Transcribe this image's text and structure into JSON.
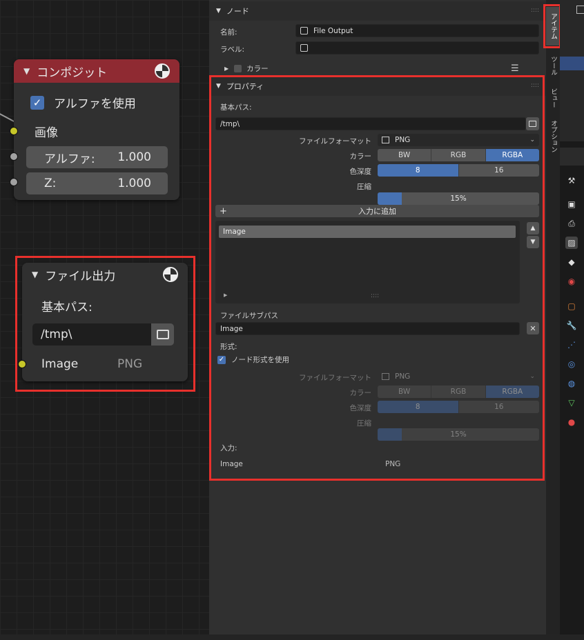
{
  "node_editor": {
    "composite_node": {
      "title": "コンポジット",
      "use_alpha_label": "アルファを使用",
      "use_alpha_checked": true,
      "image_label": "画像",
      "alpha_label": "アルファ:",
      "alpha_value": "1.000",
      "z_label": "Z:",
      "z_value": "1.000"
    },
    "file_output_node": {
      "title": "ファイル出力",
      "base_path_label": "基本パス:",
      "base_path_value": "/tmp\\",
      "input_name": "Image",
      "input_format": "PNG"
    }
  },
  "panel": {
    "node_section": {
      "title": "ノード",
      "name_label": "名前:",
      "name_value": "File Output",
      "label_label": "ラベル:",
      "label_value": "",
      "color_label": "カラー"
    },
    "properties_section": {
      "title": "プロパティ",
      "base_path_label": "基本パス:",
      "base_path_value": "/tmp\\",
      "file_format_label": "ファイルフォーマット",
      "file_format_value": "PNG",
      "color_label": "カラー",
      "color_options": [
        "BW",
        "RGB",
        "RGBA"
      ],
      "color_selected": "RGBA",
      "depth_label": "色深度",
      "depth_options": [
        "8",
        "16"
      ],
      "depth_selected": "8",
      "compression_label": "圧縮",
      "compression_value": "15%",
      "compression_fraction": 0.15,
      "add_input_label": "入力に追加",
      "input_list": [
        "Image"
      ],
      "file_subpath_label": "ファイルサブパス",
      "file_subpath_value": "Image",
      "format_label": "形式:",
      "use_node_format_label": "ノード形式を使用",
      "use_node_format_checked": true,
      "sub_file_format_label": "ファイルフォーマット",
      "sub_file_format_value": "PNG",
      "sub_color_label": "カラー",
      "sub_color_options": [
        "BW",
        "RGB",
        "RGBA"
      ],
      "sub_color_selected": "RGBA",
      "sub_depth_label": "色深度",
      "sub_depth_options": [
        "8",
        "16"
      ],
      "sub_depth_selected": "8",
      "sub_compression_label": "圧縮",
      "sub_compression_value": "15%",
      "inputs_label": "入力:",
      "inputs_row_name": "Image",
      "inputs_row_format": "PNG"
    }
  },
  "side_tabs": [
    "アイテム",
    "ツール",
    "ビュー",
    "オプション"
  ],
  "colors": {
    "accent": "#4772b3",
    "composite_header": "#8f2a32",
    "highlight_box": "#e8302c",
    "socket_yellow": "#c7c729",
    "socket_gray": "#a1a1a1"
  }
}
